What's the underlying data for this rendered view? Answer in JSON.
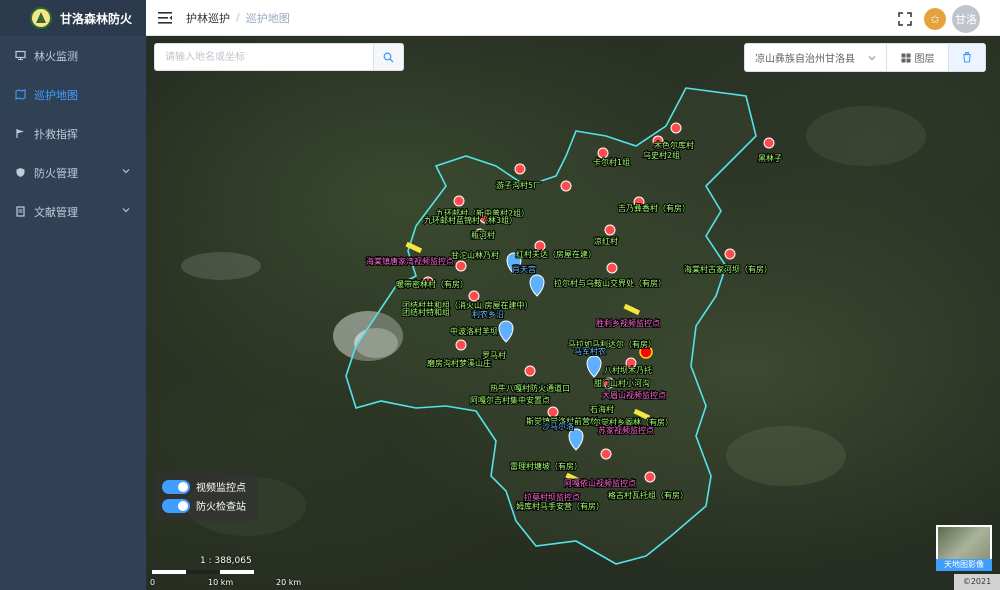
{
  "app": {
    "title": "甘洛森林防火"
  },
  "sidebar": {
    "items": [
      {
        "label": "林火监测",
        "icon": "monitor-icon"
      },
      {
        "label": "巡护地图",
        "icon": "map-icon",
        "active": true
      },
      {
        "label": "扑救指挥",
        "icon": "command-icon"
      },
      {
        "label": "防火管理",
        "icon": "shield-icon",
        "expandable": true
      },
      {
        "label": "文献管理",
        "icon": "document-icon",
        "expandable": true
      }
    ]
  },
  "header": {
    "breadcrumb": [
      "护林巡护",
      "巡护地图"
    ],
    "user_initials": "甘洛"
  },
  "map": {
    "search_placeholder": "请输入地名或坐标",
    "region": "凉山彝族自治州甘洛县",
    "layer_label": "图层",
    "toggles": [
      {
        "label": "视频监控点",
        "on": true
      },
      {
        "label": "防火检查站",
        "on": true
      }
    ],
    "scale": {
      "ratio": "1 : 388,065",
      "ticks": [
        "0",
        "10 km",
        "20 km"
      ]
    },
    "minimap_label": "天地图影像",
    "copyright": "©2021",
    "labels": [
      {
        "text": "木色尔库村",
        "kind": "village"
      },
      {
        "text": "黑林子",
        "kind": "village"
      },
      {
        "text": "卡尔村1组",
        "kind": "village"
      },
      {
        "text": "乌史村2组",
        "kind": "village"
      },
      {
        "text": "游子沟村5厂",
        "kind": "village"
      },
      {
        "text": "吉乃彝香村（有房）",
        "kind": "village"
      },
      {
        "text": "九环邮村（新中普村2组）",
        "kind": "village"
      },
      {
        "text": "九环邮村蓝锦村（林3组）",
        "kind": "village"
      },
      {
        "text": "瓶河村",
        "kind": "village"
      },
      {
        "text": "凉红村",
        "kind": "village"
      },
      {
        "text": "海棠镇唐家湾视频监控点",
        "kind": "camera"
      },
      {
        "text": "甘沱山林乃村",
        "kind": "village"
      },
      {
        "text": "红村夫达（房屋在建）",
        "kind": "village"
      },
      {
        "text": "海棠村古家河坝（有房）",
        "kind": "village"
      },
      {
        "text": "肖天宫",
        "kind": "station"
      },
      {
        "text": "暖带密林村（有房）",
        "kind": "village"
      },
      {
        "text": "拉尔村与乌鞍山交界处（有房）",
        "kind": "village"
      },
      {
        "text": "团结村共和组（消火山 房屋在建中）",
        "kind": "village"
      },
      {
        "text": "团结村特和组",
        "kind": "village"
      },
      {
        "text": "利农乡沿",
        "kind": "station"
      },
      {
        "text": "胜利乡视频监控点",
        "kind": "camera"
      },
      {
        "text": "中波洛村羊坝",
        "kind": "village"
      },
      {
        "text": "马拉如马利达尔（有房）",
        "kind": "village"
      },
      {
        "text": "马军村农",
        "kind": "station"
      },
      {
        "text": "罗马村",
        "kind": "village"
      },
      {
        "text": "磨房沟村梦溪山庄",
        "kind": "village"
      },
      {
        "text": "八村坝木乃托",
        "kind": "village"
      },
      {
        "text": "甜门山村小河沟",
        "kind": "village"
      },
      {
        "text": "热牛八嘎村防火通道口",
        "kind": "village"
      },
      {
        "text": "阿嘎尔吉村集中安置点",
        "kind": "village"
      },
      {
        "text": "大眉山视频监控点",
        "kind": "camera"
      },
      {
        "text": "石海村",
        "kind": "village"
      },
      {
        "text": "斯觉镇觉洛村前营村",
        "kind": "village"
      },
      {
        "text": "尔觉村乡阁林（有房）",
        "kind": "village"
      },
      {
        "text": "沙马尔洛",
        "kind": "station"
      },
      {
        "text": "苏家视频监控点",
        "kind": "camera"
      },
      {
        "text": "雷理村塘坡（有房）",
        "kind": "village"
      },
      {
        "text": "阿嘎依山视频监控点",
        "kind": "camera"
      },
      {
        "text": "格古村瓦托组（有房）",
        "kind": "village"
      },
      {
        "text": "拉莫村坝监控点",
        "kind": "camera"
      },
      {
        "text": "姆库村马手安营（有房）",
        "kind": "village"
      }
    ]
  }
}
